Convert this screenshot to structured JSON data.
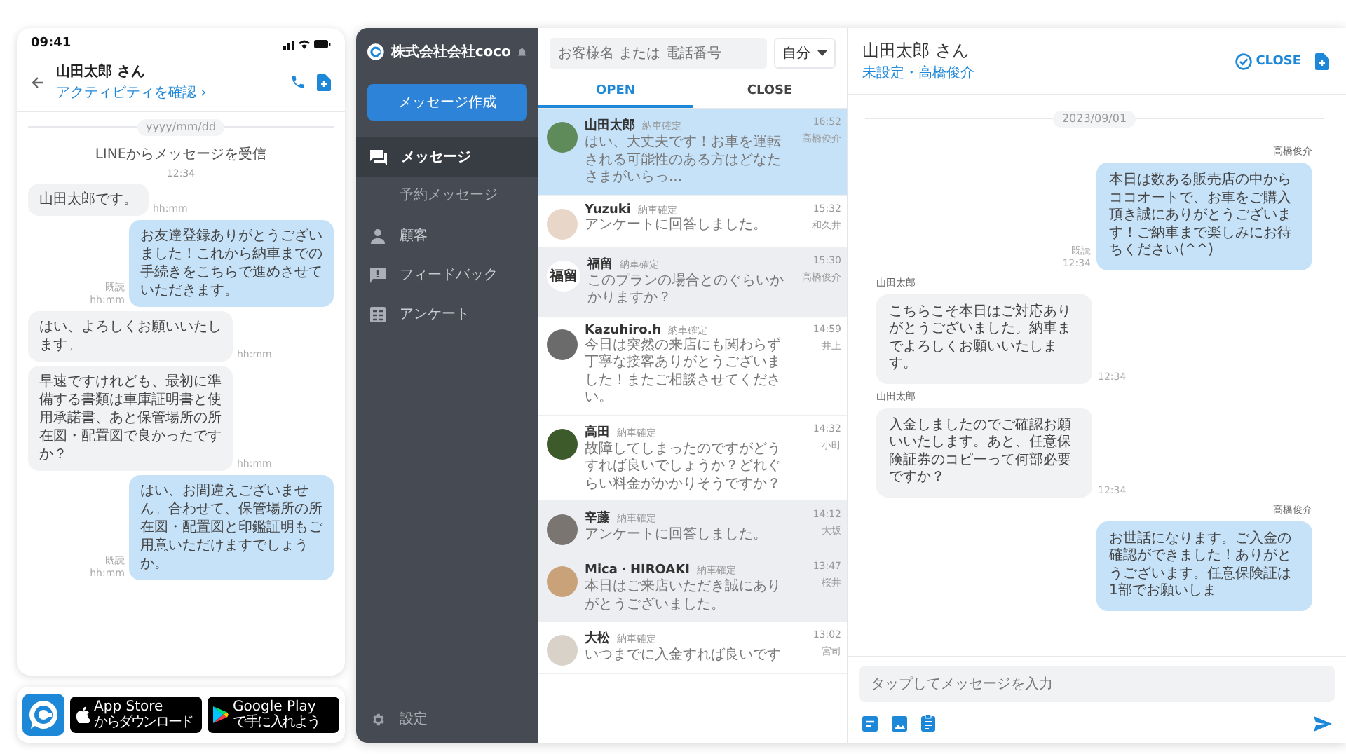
{
  "phone": {
    "status_time": "09:41",
    "contact_name": "山田太郎 さん",
    "activity_link": "アクティビティを確認 ›",
    "date_divider": "yyyy/mm/dd",
    "system_message": "LINEからメッセージを受信",
    "system_time": "12:34",
    "messages": [
      {
        "kind": "incoming",
        "text": "山田太郎です。",
        "time": "hh:mm"
      },
      {
        "kind": "outgoing",
        "text": "お友達登録ありがとうございました！これから納車までの手続きをこちらで進めさせていただきます。",
        "read": "既読",
        "time": "hh:mm"
      },
      {
        "kind": "incoming",
        "text": "はい、よろしくお願いいたします。",
        "time": "hh:mm"
      },
      {
        "kind": "incoming",
        "text": "早速ですけれども、最初に準備する書類は車庫証明書と使用承諾書、あと保管場所の所在図・配置図で良かったですか？",
        "time": "hh:mm"
      },
      {
        "kind": "outgoing",
        "text": "はい、お間違えございません。合わせて、保管場所の所在図・配置図と印鑑証明もご用意いただけますでしょうか。",
        "read": "既読",
        "time": "hh:mm"
      }
    ]
  },
  "store_badges": [
    {
      "kind": "apple",
      "title": "App Store",
      "subtitle": "からダウンロード"
    },
    {
      "kind": "google",
      "title": "Google Play",
      "subtitle": "で手に入れよう"
    }
  ],
  "sidebar": {
    "company": "株式会社会社coco",
    "compose_button": "メッセージ作成",
    "items": [
      {
        "label": "メッセージ",
        "selected": true,
        "children": [
          {
            "label": "予約メッセージ",
            "selected": false
          }
        ]
      },
      {
        "label": "顧客",
        "selected": false
      },
      {
        "label": "フィードバック",
        "selected": false
      },
      {
        "label": "アンケート",
        "selected": false
      }
    ],
    "settings": "設定"
  },
  "conversation_list": {
    "search_placeholder": "お客様名 または 電話番号",
    "filter": "自分",
    "tabs": [
      {
        "label": "OPEN",
        "selected": true
      },
      {
        "label": "CLOSE",
        "selected": false
      }
    ],
    "items": [
      {
        "name": "山田太郎",
        "tag": "納車確定",
        "time": "16:52",
        "assignee": "高橋俊介",
        "preview": "はい、大丈夫です！お車を運転される可能性のある方はどなたさまがいらっ...",
        "selected": true
      },
      {
        "name": "Yuzuki",
        "tag": "納車確定",
        "time": "15:32",
        "assignee": "和久井",
        "preview": "アンケートに回答しました。",
        "selected": false,
        "shaded": false
      },
      {
        "name": "福留",
        "avatar_text": "福留",
        "tag": "納車確定",
        "time": "15:30",
        "assignee": "高橋俊介",
        "preview": "このプランの場合とのぐらいかかりますか？",
        "selected": false,
        "shaded": true
      },
      {
        "name": "Kazuhiro.h",
        "tag": "納車確定",
        "time": "14:59",
        "assignee": "井上",
        "preview": "今日は突然の来店にも関わらず丁寧な接客ありがとうございました！またご相談させてください。",
        "selected": false,
        "shaded": false
      },
      {
        "name": "高田",
        "tag": "納車確定",
        "time": "14:32",
        "assignee": "小町",
        "preview": "故障してしまったのですがどうすれば良いでしょうか？どれぐらい料金がかかりそうですか？",
        "selected": false,
        "shaded": false
      },
      {
        "name": "辛藤",
        "tag": "納車確定",
        "time": "14:12",
        "assignee": "大坂",
        "preview": "アンケートに回答しました。",
        "selected": false,
        "shaded": true
      },
      {
        "name": "Mica・HIROAKI",
        "tag": "納車確定",
        "time": "13:47",
        "assignee": "桜井",
        "preview": "本日はご来店いただき誠にありがとうございました。",
        "selected": false,
        "shaded": true
      },
      {
        "name": "大松",
        "tag": "納車確定",
        "time": "13:02",
        "assignee": "宮司",
        "preview": "いつまでに入金すれば良いです",
        "selected": false,
        "shaded": false
      }
    ]
  },
  "chat": {
    "contact_name": "山田太郎 さん",
    "subtitle": "未設定・高橋俊介",
    "close_button": "CLOSE",
    "date_divider": "2023/09/01",
    "messages": [
      {
        "kind": "outgoing",
        "sender": "高橋俊介",
        "text": "本日は数ある販売店の中からココオートで、お車をご購入頂き誠にありがとうございます！ご納車まで楽しみにお待ちください(^^)",
        "read": "既読",
        "time": "12:34"
      },
      {
        "kind": "incoming",
        "sender": "山田太郎",
        "text": "こちらこそ本日はご対応ありがとうございました。納車までよろしくお願いいたします。",
        "time": "12:34"
      },
      {
        "kind": "incoming",
        "sender": "山田太郎",
        "text": "入金しましたのでご確認お願いいたします。あと、任意保険証券のコピーって何部必要ですか？",
        "time": "12:34"
      },
      {
        "kind": "outgoing",
        "sender": "高橋俊介",
        "text": "お世話になります。ご入金の確認ができました！ありがとうございます。任意保険証は1部でお願いしま"
      }
    ],
    "input_placeholder": "タップしてメッセージを入力"
  }
}
